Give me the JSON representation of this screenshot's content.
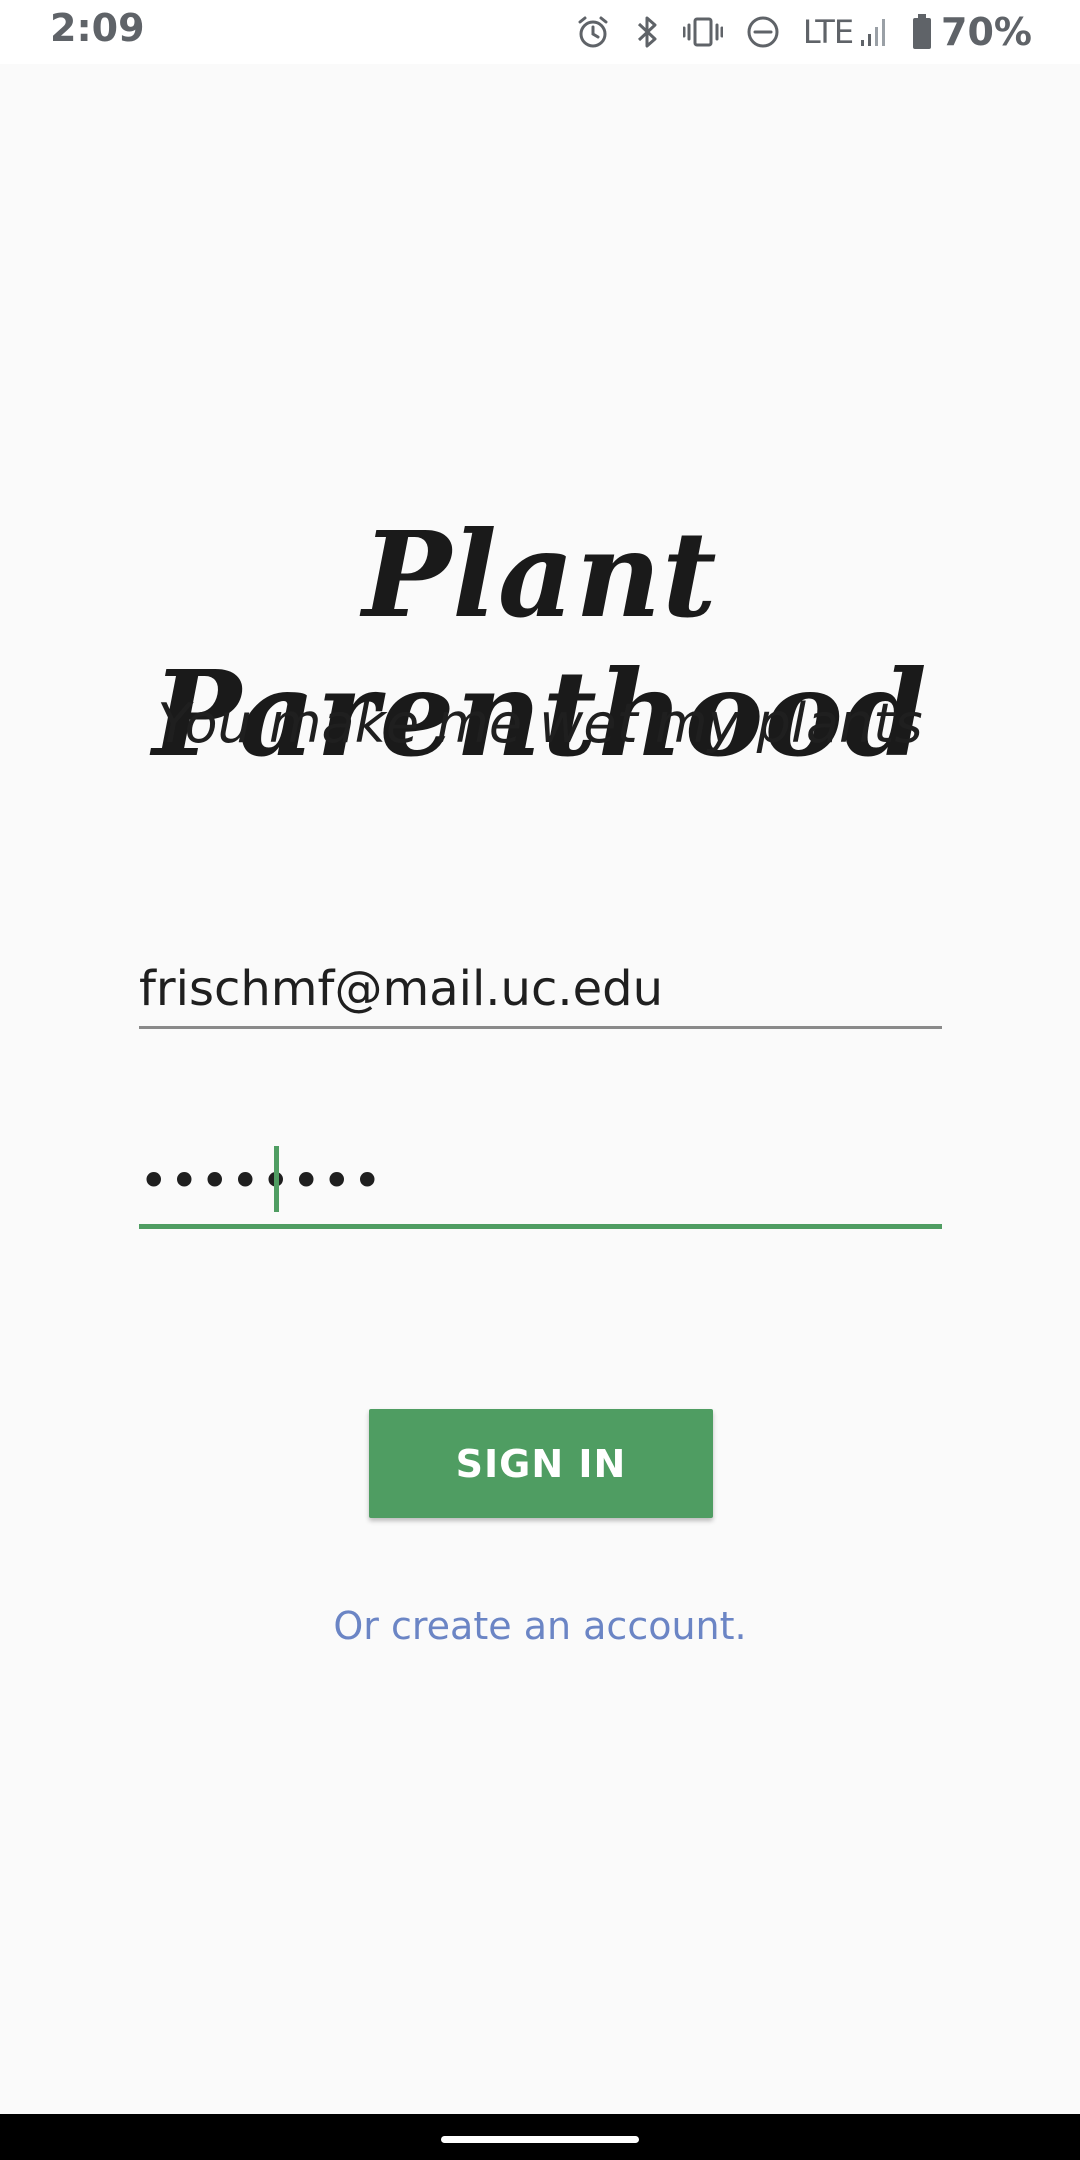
{
  "status_bar": {
    "time": "2:09",
    "network": "LTE",
    "battery": "70%",
    "icons": [
      "alarm-icon",
      "bluetooth-icon",
      "vibrate-icon",
      "do-not-disturb-icon",
      "signal-icon",
      "battery-icon"
    ]
  },
  "app": {
    "title": "Plant Parenthood",
    "tagline": "You make me wet my plants"
  },
  "form": {
    "email_value": "frischmf@mail.uc.edu",
    "password_masked": "••••••••",
    "sign_in_label": "SIGN IN",
    "create_account_label": "Or create an account."
  },
  "colors": {
    "accent": "#4f9d62",
    "link": "#6b85c5",
    "background": "#fafafa"
  }
}
